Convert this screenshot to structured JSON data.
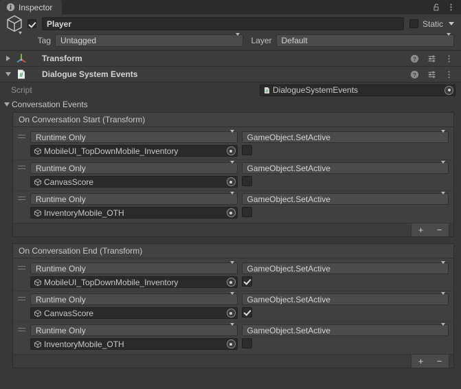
{
  "window": {
    "tab_label": "Inspector",
    "tab_icon": "info-icon",
    "lock_icon": "lock-icon",
    "menu_icon": "kebab-menu-icon"
  },
  "gameobject": {
    "enabled": true,
    "name": "Player",
    "static_label": "Static",
    "static_checked": false,
    "tag_label": "Tag",
    "tag_value": "Untagged",
    "layer_label": "Layer",
    "layer_value": "Default",
    "prefab_icon": "cube-icon"
  },
  "components": [
    {
      "name": "Transform",
      "icon": "transform-axis-icon",
      "expanded": false
    },
    {
      "name": "Dialogue System Events",
      "icon": "csharp-script-icon",
      "expanded": true
    }
  ],
  "component_tools": {
    "help_icon": "help-icon",
    "preset_icon": "preset-sliders-icon",
    "menu_icon": "kebab-menu-icon"
  },
  "dialogue_system_events": {
    "script_label": "Script",
    "script_value": "DialogueSystemEvents",
    "script_icon": "csharp-script-icon",
    "conversation_events_label": "Conversation Events",
    "conversation_events_expanded": true,
    "event_lists": [
      {
        "title": "On Conversation Start (Transform)",
        "add_label": "+",
        "remove_label": "−",
        "entries": [
          {
            "call_state": "Runtime Only",
            "target": "MobileUI_TopDownMobile_Inventory",
            "method": "GameObject.SetActive",
            "bool_arg": false
          },
          {
            "call_state": "Runtime Only",
            "target": "CanvasScore",
            "method": "GameObject.SetActive",
            "bool_arg": false
          },
          {
            "call_state": "Runtime Only",
            "target": "InventoryMobile_OTH",
            "method": "GameObject.SetActive",
            "bool_arg": false
          }
        ]
      },
      {
        "title": "On Conversation End (Transform)",
        "add_label": "+",
        "remove_label": "−",
        "entries": [
          {
            "call_state": "Runtime Only",
            "target": "MobileUI_TopDownMobile_Inventory",
            "method": "GameObject.SetActive",
            "bool_arg": true
          },
          {
            "call_state": "Runtime Only",
            "target": "CanvasScore",
            "method": "GameObject.SetActive",
            "bool_arg": true
          },
          {
            "call_state": "Runtime Only",
            "target": "InventoryMobile_OTH",
            "method": "GameObject.SetActive",
            "bool_arg": false
          }
        ]
      }
    ]
  },
  "colors": {
    "panel_bg": "#383838",
    "header_bg": "#3c3c3c",
    "tabbar_bg": "#2b2b2b",
    "field_bg": "#2a2a2a",
    "dropdown_bg": "#4b2b2b",
    "text": "#c4c4c4"
  }
}
